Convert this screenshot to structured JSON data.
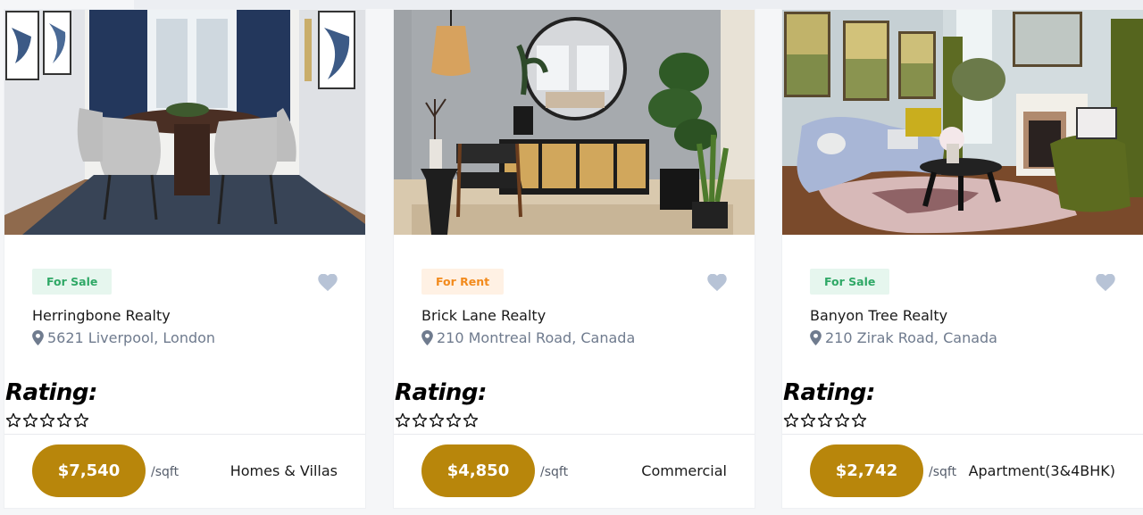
{
  "listings": [
    {
      "status": "For Sale",
      "status_type": "sale",
      "title": "Herringbone Realty",
      "address": "5621 Liverpool, London",
      "rating_label": "Rating:",
      "rating": 0,
      "rating_max": 5,
      "price": "$7,540",
      "price_unit": "/sqft",
      "category": "Homes & Villas",
      "photo": "dining-room-photo"
    },
    {
      "status": "For Rent",
      "status_type": "rent",
      "title": "Brick Lane Realty",
      "address": "210 Montreal Road, Canada",
      "rating_label": "Rating:",
      "rating": 0,
      "rating_max": 5,
      "price": "$4,850",
      "price_unit": "/sqft",
      "category": "Commercial",
      "photo": "entryway-photo"
    },
    {
      "status": "For Sale",
      "status_type": "sale",
      "title": "Banyon Tree Realty",
      "address": "210 Zirak Road, Canada",
      "rating_label": "Rating:",
      "rating": 0,
      "rating_max": 5,
      "price": "$2,742",
      "price_unit": "/sqft",
      "category": "Apartment(3&4BHK)",
      "photo": "living-room-photo"
    }
  ],
  "colors": {
    "accent": "#b8860b",
    "sale_bg": "#e6f6ee",
    "sale_text": "#2fa866",
    "rent_bg": "#fff1e4",
    "rent_text": "#f28a1c",
    "heart": "#b7c3d6",
    "muted_text": "#6f7b8e"
  },
  "icons": {
    "favorite": "heart-icon",
    "location": "map-pin-icon",
    "rating": "star-outline-icon"
  }
}
